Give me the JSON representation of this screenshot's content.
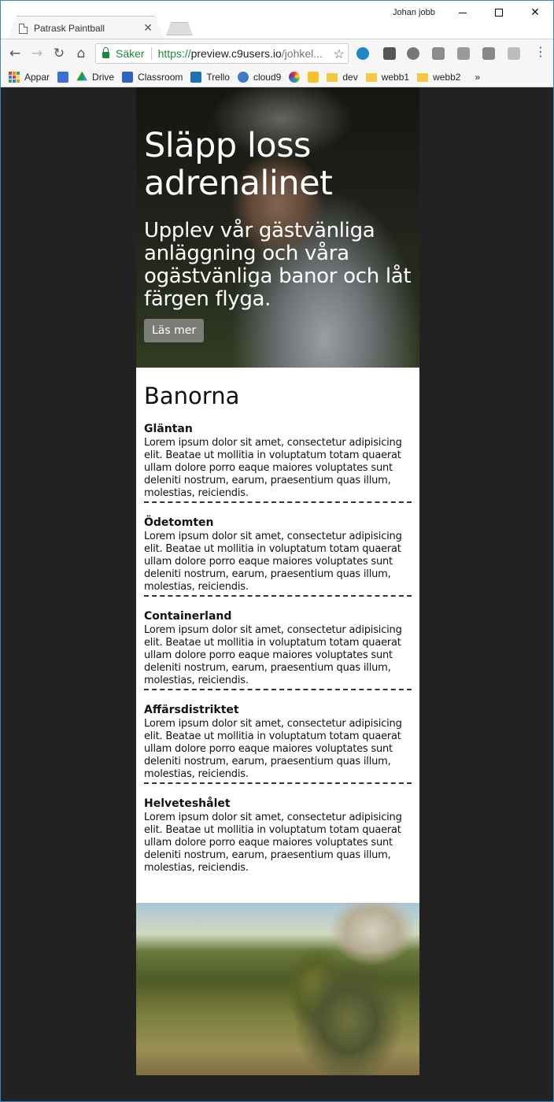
{
  "browser": {
    "tab_title": "Patrask Paintball",
    "user_label": "Johan jobb",
    "secure_label": "Säker",
    "url_scheme": "https://",
    "url_host": "preview.c9users.io",
    "url_tail": "/johkel...",
    "bookmarks": [
      {
        "label": "Appar",
        "icon": "apps-grid-icon"
      },
      {
        "label": "",
        "icon": "calendar-icon",
        "color": "#3b6fd8"
      },
      {
        "label": "Drive",
        "icon": "drive-icon"
      },
      {
        "label": "Classroom",
        "icon": "classroom-icon",
        "color": "#2f62c4"
      },
      {
        "label": "Trello",
        "icon": "trello-icon",
        "color": "#1f6fb5"
      },
      {
        "label": "cloud9",
        "icon": "cloud9-icon",
        "color": "#3f7bc4"
      },
      {
        "label": "",
        "icon": "pinwheel-icon"
      },
      {
        "label": "",
        "icon": "keep-icon",
        "color": "#f6c026"
      },
      {
        "label": "dev",
        "icon": "folder-icon"
      },
      {
        "label": "webb1",
        "icon": "folder-icon"
      },
      {
        "label": "webb2",
        "icon": "folder-icon"
      }
    ],
    "overflow": "»"
  },
  "hero": {
    "title": "Släpp loss adrenalinet",
    "subtitle": "Upplev vår gästvänliga anläggning och våra ogästvänliga banor och låt färgen flyga.",
    "button": "Läs mer"
  },
  "courses": {
    "heading": "Banorna",
    "items": [
      {
        "name": "Gläntan",
        "text": "Lorem ipsum dolor sit amet, consectetur adipisicing elit. Beatae ut mollitia in voluptatum totam quaerat ullam dolore porro eaque maiores voluptates sunt deleniti nostrum, earum, praesentium quas illum, molestias, reiciendis."
      },
      {
        "name": "Ödetomten",
        "text": "Lorem ipsum dolor sit amet, consectetur adipisicing elit. Beatae ut mollitia in voluptatum totam quaerat ullam dolore porro eaque maiores voluptates sunt deleniti nostrum, earum, praesentium quas illum, molestias, reiciendis."
      },
      {
        "name": "Containerland",
        "text": "Lorem ipsum dolor sit amet, consectetur adipisicing elit. Beatae ut mollitia in voluptatum totam quaerat ullam dolore porro eaque maiores voluptates sunt deleniti nostrum, earum, praesentium quas illum, molestias, reiciendis."
      },
      {
        "name": "Affärsdistriktet",
        "text": "Lorem ipsum dolor sit amet, consectetur adipisicing elit. Beatae ut mollitia in voluptatum totam quaerat ullam dolore porro eaque maiores voluptates sunt deleniti nostrum, earum, praesentium quas illum, molestias, reiciendis."
      },
      {
        "name": "Helveteshålet",
        "text": "Lorem ipsum dolor sit amet, consectetur adipisicing elit. Beatae ut mollitia in voluptatum totam quaerat ullam dolore porro eaque maiores voluptates sunt deleniti nostrum, earum, praesentium quas illum, molestias, reiciendis."
      }
    ]
  },
  "colors": {
    "page_background": "#222222",
    "secure_green": "#1a8a3a",
    "frame_blue": "#3b83c4"
  }
}
